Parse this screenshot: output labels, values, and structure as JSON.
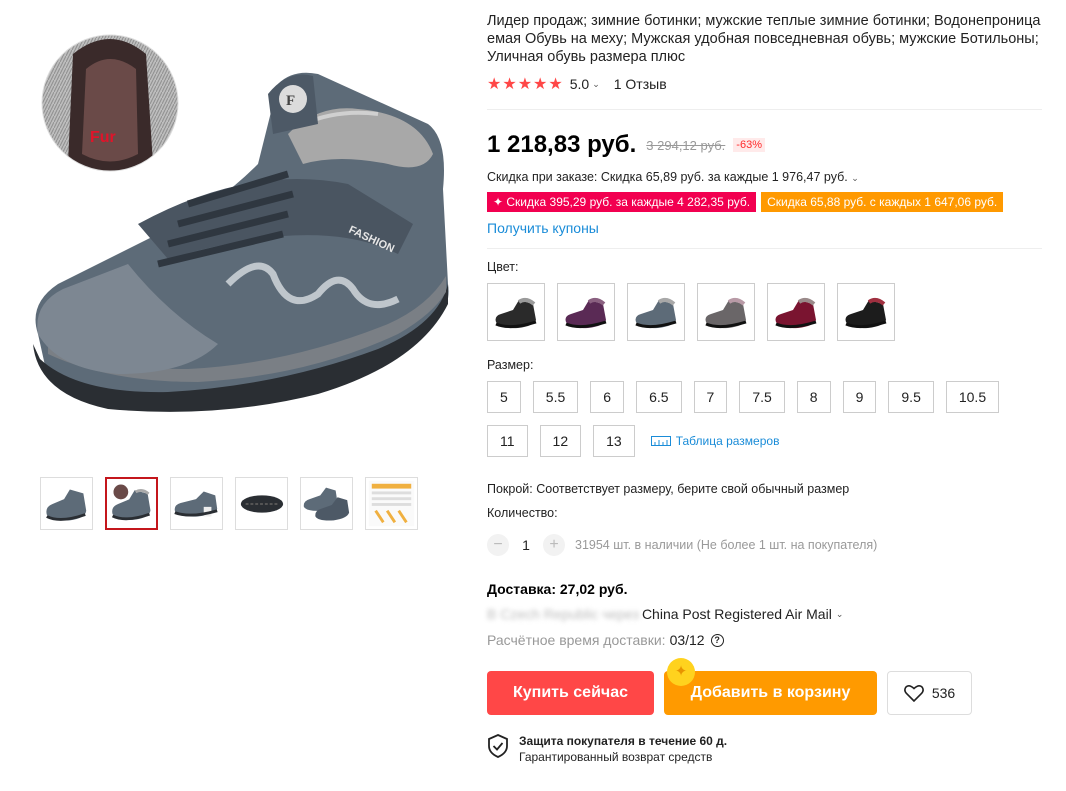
{
  "product": {
    "title": "Лидер продаж; зимние ботинки; мужские теплые зимние ботинки; Водонепроницаемая Обувь на меху; Мужская удобная повседневная обувь; мужские Ботильоны; Уличная обувь размера плюс",
    "stars": "★★★★★",
    "rating": "5.0",
    "reviews": "1 Отзыв"
  },
  "gallery": {
    "inset_label": "Fur",
    "thumbnails": [
      "boot-side-grey",
      "boot-side-grey-fur",
      "boot-grey-tagged",
      "boot-sole",
      "boot-pair",
      "size-chart"
    ]
  },
  "price": {
    "current": "1 218,83 руб.",
    "old": "3 294,12 руб.",
    "discount": "-63%",
    "order_discount": "Скидка при заказе: Скидка 65,89 руб. за каждые 1 976,47 руб.",
    "coupon_red": "✦ Скидка 395,29 руб. за каждые 4 282,35 руб.",
    "coupon_orange": "Скидка 65,88 руб. с каждых 1 647,06 руб.",
    "get_coupons": "Получить купоны"
  },
  "options": {
    "color_label": "Цвет:",
    "colors": [
      {
        "name": "black-grey",
        "body": "#2a2a2a",
        "fur": "#9a9a9a"
      },
      {
        "name": "purple",
        "body": "#5a2a55",
        "fur": "#8a6080"
      },
      {
        "name": "grey-blue",
        "body": "#5d6b78",
        "fur": "#a8a8a8"
      },
      {
        "name": "grey",
        "body": "#6a6668",
        "fur": "#b89aa6"
      },
      {
        "name": "wine-red",
        "body": "#7a1430",
        "fur": "#9a8a8a"
      },
      {
        "name": "black-red",
        "body": "#1c1c1c",
        "fur": "#a03040"
      }
    ],
    "size_label": "Размер:",
    "sizes": [
      "5",
      "5.5",
      "6",
      "6.5",
      "7",
      "7.5",
      "8",
      "9",
      "9.5",
      "10.5",
      "11",
      "12",
      "13"
    ],
    "size_table": "Таблица размеров",
    "fit": "Покрой: Соответствует размеру, берите свой обычный размер",
    "qty_label": "Количество:",
    "qty_minus": "−",
    "qty_value": "1",
    "qty_plus": "+",
    "stock": "31954 шт. в наличии (Не более 1 шт. на покупателя)"
  },
  "shipping": {
    "price": "Доставка: 27,02 руб.",
    "destination_blurred": "В Czech Republic через",
    "method": "China Post Registered Air Mail",
    "eta_label": "Расчётное время доставки:",
    "eta_value": "03/12"
  },
  "actions": {
    "buy_now": "Купить сейчас",
    "add_to_cart": "Добавить в корзину",
    "wishlist_count": "536"
  },
  "protection": {
    "title": "Защита покупателя в течение 60 д.",
    "subtitle": "Гарантированный возврат средств"
  },
  "colors": {
    "accent_red": "#ff4747",
    "accent_orange": "#ff9a00",
    "link_blue": "#1a8cd8",
    "boot_grey": "#5d6b78"
  }
}
